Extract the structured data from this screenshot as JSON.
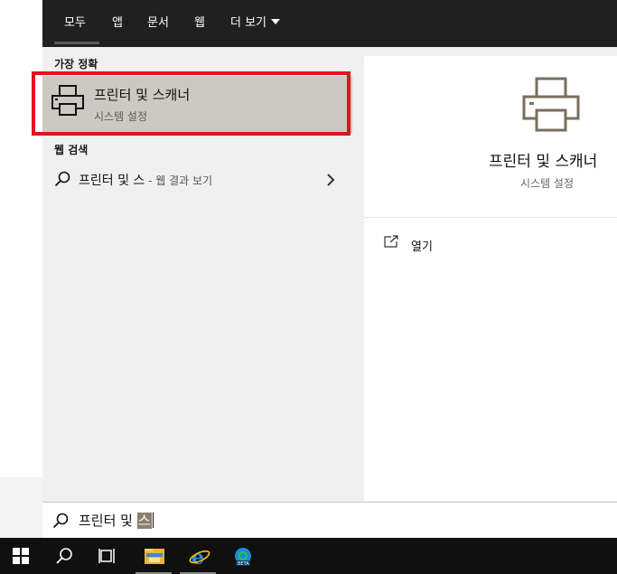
{
  "tabs": [
    {
      "label": "모두",
      "active": true
    },
    {
      "label": "앱"
    },
    {
      "label": "문서"
    },
    {
      "label": "웹"
    },
    {
      "label": "더 보기"
    }
  ],
  "best_match": {
    "section_label": "가장 정확",
    "title": "프린터 및 스캐너",
    "subtitle": "시스템 설정",
    "icon": "printer-icon"
  },
  "web_search": {
    "section_label": "웹 검색",
    "query": "프린터 및 스",
    "suffix": " - 웹 결과 보기"
  },
  "preview": {
    "title": "프린터 및 스캐너",
    "subtitle": "시스템 설정",
    "open_label": "열기"
  },
  "search_box": {
    "text_prefix": "프린터 및 ",
    "text_selected": "스"
  },
  "taskbar": {
    "items": [
      "windows-start-icon",
      "search-icon",
      "task-view-icon",
      "file-explorer-icon",
      "internet-explorer-icon",
      "edge-beta-icon"
    ]
  },
  "colors": {
    "tabbar_bg": "#202020",
    "panel_bg": "#f0f0f0",
    "selected_item_bg": "#ccc9c2",
    "highlight_border": "#e0141e",
    "taskbar_bg": "#101010",
    "icon_color": "#7a6f5d"
  }
}
